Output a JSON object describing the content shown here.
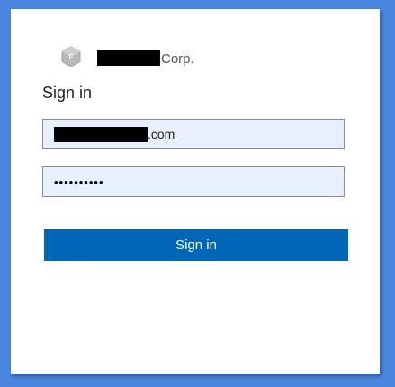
{
  "brand": {
    "name_suffix": "Corp.",
    "logo_icon": "hexagon-logo-icon"
  },
  "signin": {
    "title": "Sign in",
    "email_value_suffix": ".com",
    "password_masked": "••••••••••",
    "button_label": "Sign in"
  },
  "colors": {
    "background": "#4a86df",
    "button": "#0067b8",
    "field_background": "#e8f0fe"
  }
}
